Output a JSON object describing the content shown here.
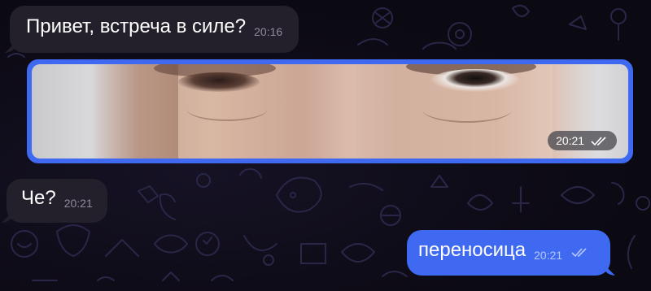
{
  "messages": [
    {
      "direction": "incoming",
      "text": "Привет, встреча в силе?",
      "time": "20:16"
    },
    {
      "direction": "outgoing",
      "type": "photo",
      "image_icon": "face-eyes-closeup-photo",
      "time": "20:21",
      "status_icon": "double-check-icon"
    },
    {
      "direction": "incoming",
      "text": "Че?",
      "time": "20:21"
    },
    {
      "direction": "outgoing",
      "text": "переносица",
      "time": "20:21",
      "status_icon": "double-check-icon"
    }
  ],
  "colors": {
    "background": "#0b0912",
    "incoming_bubble": "#23202c",
    "outgoing_bubble": "#3e69f0",
    "wallpaper_doodles": "#2a2648"
  }
}
